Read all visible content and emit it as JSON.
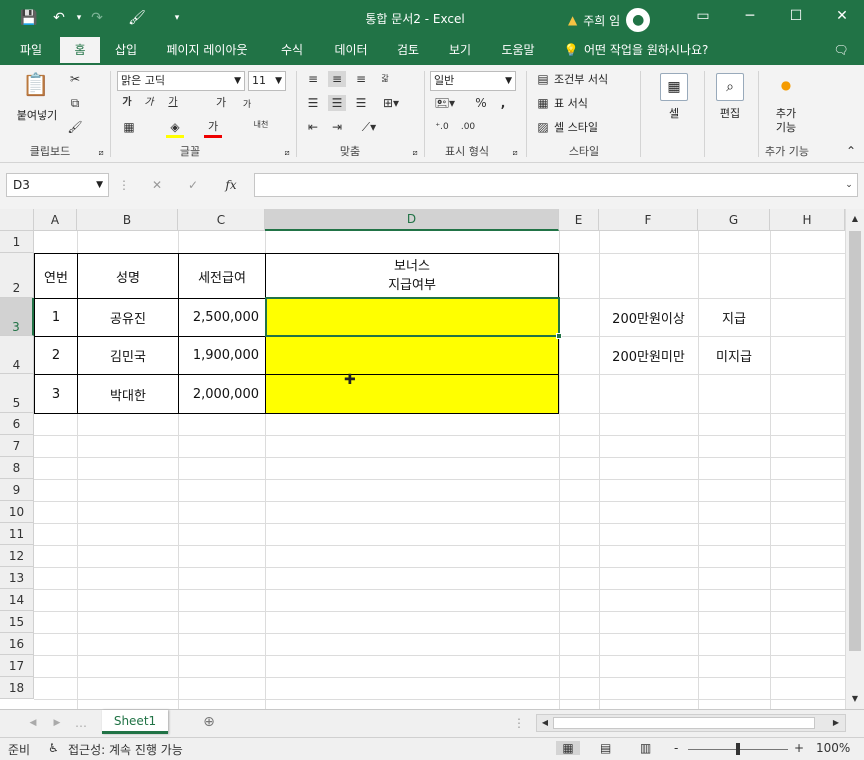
{
  "titlebar": {
    "doc_title": "통합 문서2  -  Excel",
    "warning_icon": "warning-icon",
    "user_name": "주희 임",
    "avatar_icon": "user-avatar-icon",
    "undo_dropdown": "▾",
    "redo_icon": "↷"
  },
  "tabs": [
    "파일",
    "홈",
    "삽입",
    "페이지 레이아웃",
    "수식",
    "데이터",
    "검토",
    "보기",
    "도움말",
    "어떤 작업을 원하시나요?"
  ],
  "ribbon": {
    "clipboard": {
      "paste": "붙여넣기",
      "group": "클립보드"
    },
    "font": {
      "name": "맑은 고딕",
      "size": "11",
      "bold": "가",
      "italic": "가",
      "underline": "가",
      "grow": "가",
      "shrink": "가",
      "color": "가",
      "phonetic": "내천",
      "group": "글꼴"
    },
    "align": {
      "wrap": "갋",
      "group": "맞춤"
    },
    "number": {
      "format": "일반",
      "percent": "%",
      "comma": ",",
      "group": "표시 형식"
    },
    "styles": {
      "conditional": "조건부 서식",
      "table": "표 서식",
      "cell": "셀 스타일",
      "group": "스타일"
    },
    "cells": {
      "label": "셀"
    },
    "editing": {
      "label": "편집"
    },
    "addins": {
      "label": "추가\n기능",
      "group": "추가 기능"
    }
  },
  "formula_bar": {
    "name_box": "D3",
    "fx": "fx",
    "cancel": "✕",
    "enter": "✓",
    "value": ""
  },
  "columns": [
    "A",
    "B",
    "C",
    "D",
    "E",
    "F",
    "G",
    "H"
  ],
  "rows": [
    "1",
    "2",
    "3",
    "4",
    "5",
    "6",
    "7",
    "8",
    "9",
    "10",
    "11",
    "12",
    "13",
    "14",
    "15",
    "16",
    "17",
    "18"
  ],
  "cells": {
    "A2": "연번",
    "B2": "성명",
    "C2": "세전급여",
    "D2": "보너스\n지급여부",
    "A3": "1",
    "B3": "공유진",
    "C3": "2,500,000",
    "A4": "2",
    "B4": "김민국",
    "C4": "1,900,000",
    "A5": "3",
    "B5": "박대한",
    "C5": "2,000,000",
    "F3": "200만원이상",
    "G3": "지급",
    "F4": "200만원미만",
    "G4": "미지급"
  },
  "colors": {
    "accent": "#217346",
    "highlight": "#ffff00"
  },
  "sheet_tabs": [
    "Sheet1"
  ],
  "status": {
    "ready": "준비",
    "accessibility": "접근성: 계속 진행 가능",
    "zoom": "100%",
    "zoom_minus": "-",
    "zoom_plus": "+"
  }
}
